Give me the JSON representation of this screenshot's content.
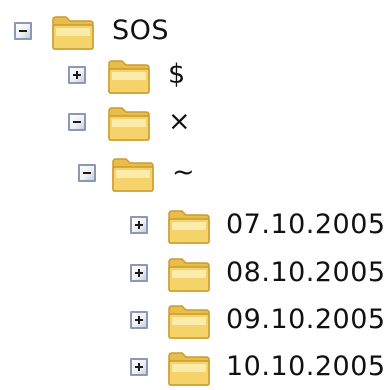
{
  "tree": {
    "nodes": [
      {
        "label": "SOS",
        "expanded": true,
        "icon": "folder-icon"
      },
      {
        "label": "$",
        "expanded": false,
        "icon": "folder-icon"
      },
      {
        "label": "×",
        "expanded": true,
        "icon": "folder-icon"
      },
      {
        "label": "~",
        "expanded": true,
        "icon": "folder-icon"
      },
      {
        "label": "07.10.2005",
        "expanded": false,
        "icon": "folder-icon"
      },
      {
        "label": "08.10.2005",
        "expanded": false,
        "icon": "folder-icon"
      },
      {
        "label": "09.10.2005",
        "expanded": false,
        "icon": "folder-icon"
      },
      {
        "label": "10.10.2005",
        "expanded": false,
        "icon": "folder-icon"
      }
    ]
  },
  "colors": {
    "folder_body": "#f6d36a",
    "folder_light": "#fdf3b9",
    "folder_edge": "#c99b2e",
    "toggle_border": "#8a99b4",
    "text": "#111111"
  }
}
